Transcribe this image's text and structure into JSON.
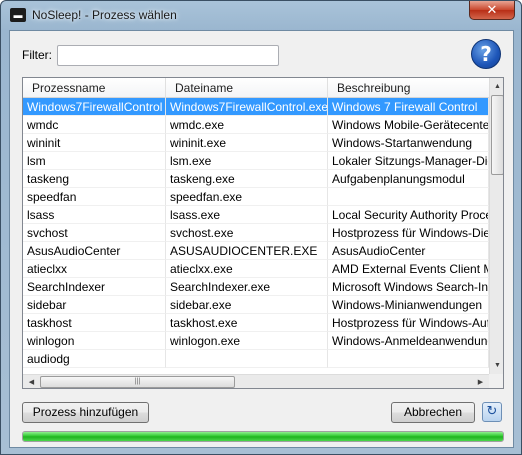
{
  "window": {
    "title": "NoSleep! - Prozess wählen",
    "close_glyph": "✕"
  },
  "filter": {
    "label": "Filter:",
    "value": "",
    "placeholder": ""
  },
  "help": {
    "glyph": "?"
  },
  "table": {
    "columns": [
      "Prozessname",
      "Dateiname",
      "Beschreibung"
    ],
    "rows": [
      {
        "name": "Windows7FirewallControl",
        "file": "Windows7FirewallControl.exe",
        "desc": "Windows 7 Firewall Control",
        "selected": true
      },
      {
        "name": "wmdc",
        "file": "wmdc.exe",
        "desc": "Windows Mobile-Gerätecenter"
      },
      {
        "name": "wininit",
        "file": "wininit.exe",
        "desc": "Windows-Startanwendung"
      },
      {
        "name": "lsm",
        "file": "lsm.exe",
        "desc": "Lokaler Sitzungs-Manager-Dienst"
      },
      {
        "name": "taskeng",
        "file": "taskeng.exe",
        "desc": "Aufgabenplanungsmodul"
      },
      {
        "name": "speedfan",
        "file": "speedfan.exe",
        "desc": ""
      },
      {
        "name": "lsass",
        "file": "lsass.exe",
        "desc": "Local Security Authority Process"
      },
      {
        "name": "svchost",
        "file": "svchost.exe",
        "desc": "Hostprozess für Windows-Dienste"
      },
      {
        "name": "AsusAudioCenter",
        "file": "ASUSAUDIOCENTER.EXE",
        "desc": "AsusAudioCenter"
      },
      {
        "name": "atieclxx",
        "file": "atieclxx.exe",
        "desc": "AMD External Events Client Module"
      },
      {
        "name": "SearchIndexer",
        "file": "SearchIndexer.exe",
        "desc": "Microsoft Windows Search-Indexer"
      },
      {
        "name": "sidebar",
        "file": "sidebar.exe",
        "desc": "Windows-Minianwendungen"
      },
      {
        "name": "taskhost",
        "file": "taskhost.exe",
        "desc": "Hostprozess für Windows-Aufgaben"
      },
      {
        "name": "winlogon",
        "file": "winlogon.exe",
        "desc": "Windows-Anmeldeanwendung"
      },
      {
        "name": "audiodg",
        "file": "",
        "desc": ""
      }
    ]
  },
  "scroll": {
    "up": "▲",
    "down": "▼",
    "left": "◀",
    "right": "▶",
    "grip": "|||"
  },
  "buttons": {
    "add_process": "Prozess hinzufügen",
    "cancel": "Abbrechen",
    "refresh_glyph": "↻"
  },
  "progress": {
    "fraction": 1.0
  },
  "colors": {
    "selection": "#3399ff",
    "progress": "#27c427"
  }
}
